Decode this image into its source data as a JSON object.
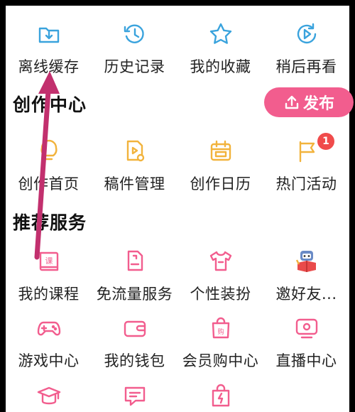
{
  "top_row": [
    {
      "label": "离线缓存",
      "icon": "download-folder-icon"
    },
    {
      "label": "历史记录",
      "icon": "history-clock-icon"
    },
    {
      "label": "我的收藏",
      "icon": "star-icon"
    },
    {
      "label": "稍后再看",
      "icon": "watch-later-icon"
    }
  ],
  "creation": {
    "title": "创作中心",
    "publish_label": "发布",
    "items": [
      {
        "label": "创作首页",
        "icon": "lightbulb-icon"
      },
      {
        "label": "稿件管理",
        "icon": "manuscript-icon"
      },
      {
        "label": "创作日历",
        "icon": "calendar-icon"
      },
      {
        "label": "热门活动",
        "icon": "flag-icon",
        "badge": "1"
      }
    ]
  },
  "services": {
    "title": "推荐服务",
    "row1": [
      {
        "label": "我的课程",
        "icon": "course-book-icon"
      },
      {
        "label": "免流量服务",
        "icon": "sim-card-icon"
      },
      {
        "label": "个性装扮",
        "icon": "tshirt-icon"
      },
      {
        "label": "邀好友...",
        "icon": "mascot-icon"
      }
    ],
    "row2": [
      {
        "label": "游戏中心",
        "icon": "gamepad-icon"
      },
      {
        "label": "我的钱包",
        "icon": "wallet-icon"
      },
      {
        "label": "会员购中心",
        "icon": "shopping-bag-icon"
      },
      {
        "label": "直播中心",
        "icon": "tv-icon"
      }
    ],
    "row3": [
      {
        "icon": "graduation-cap-icon"
      },
      {
        "icon": "chat-bubble-icon"
      },
      {
        "icon": "flash-bag-icon"
      }
    ]
  },
  "colors": {
    "blue": "#3aa3dd",
    "yellow": "#f2b33c",
    "pink": "#f25d8e",
    "badge": "#f04b4b"
  }
}
